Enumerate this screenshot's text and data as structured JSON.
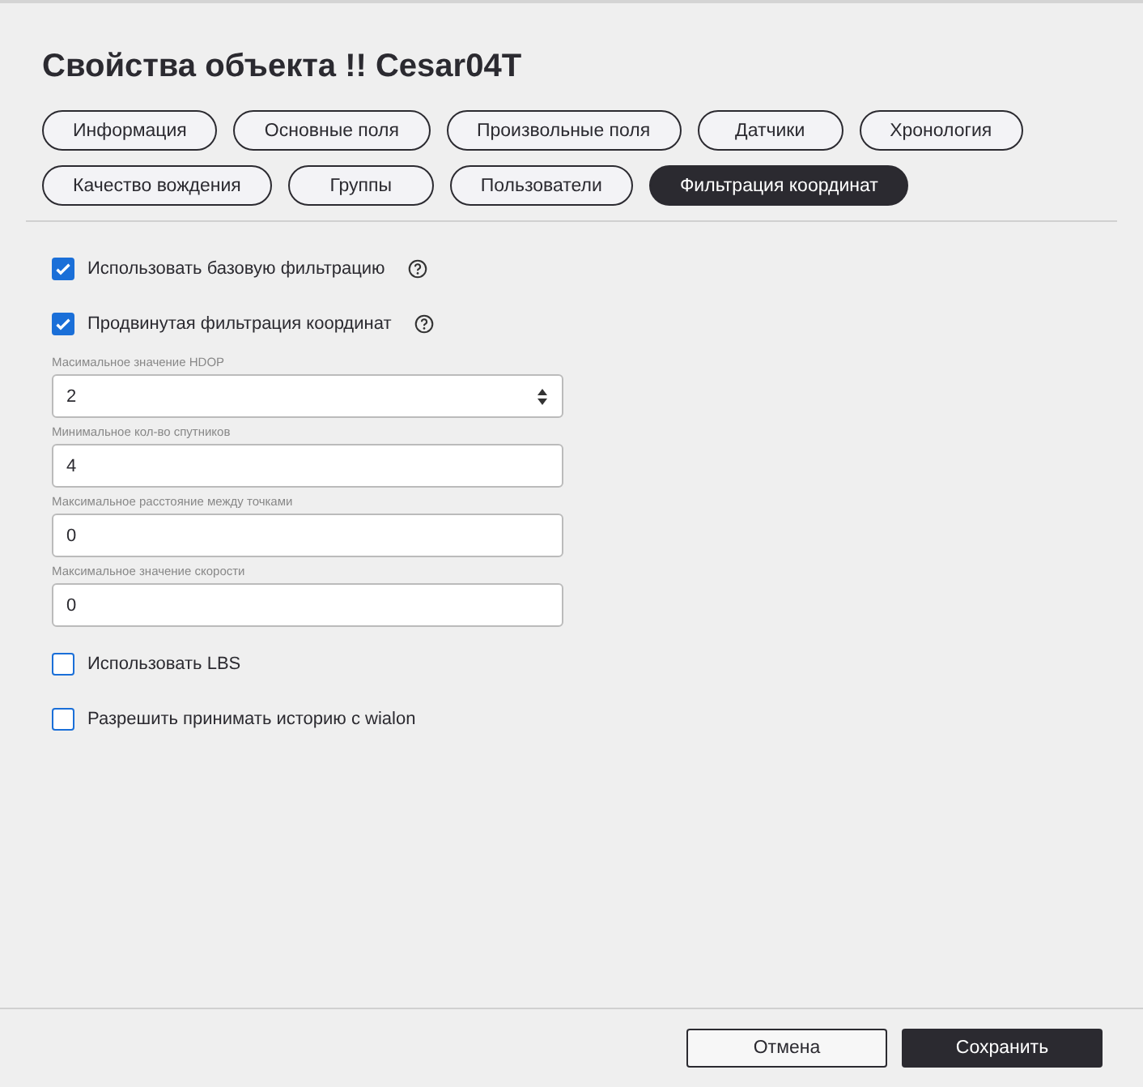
{
  "title": "Свойства объекта !! Cesar04T",
  "tabs": [
    {
      "label": "Информация",
      "selected": false
    },
    {
      "label": "Основные поля",
      "selected": false
    },
    {
      "label": "Произвольные поля",
      "selected": false
    },
    {
      "label": "Датчики",
      "selected": false
    },
    {
      "label": "Хронология",
      "selected": false
    },
    {
      "label": "Качество вождения",
      "selected": false
    },
    {
      "label": "Группы",
      "selected": false
    },
    {
      "label": "Пользователи",
      "selected": false
    },
    {
      "label": "Фильтрация координат",
      "selected": true
    }
  ],
  "settings": [
    {
      "kind": "checkbox",
      "label": "Использовать базовую фильтрацию",
      "checked": true,
      "help": true
    },
    {
      "kind": "checkbox",
      "label": "Продвинутая фильтрация координат",
      "checked": true,
      "help": true
    },
    {
      "kind": "field",
      "label": "Масимальное значение HDOP",
      "value": "2",
      "spinner": true
    },
    {
      "kind": "field",
      "label": "Минимальное кол-во спутников",
      "value": "4",
      "spinner": false
    },
    {
      "kind": "field",
      "label": "Максимальное расстояние между точками",
      "value": "0",
      "spinner": false
    },
    {
      "kind": "field",
      "label": "Максимальное значение скорости",
      "value": "0",
      "spinner": false
    },
    {
      "kind": "checkbox",
      "label": "Использовать LBS",
      "checked": false,
      "help": false
    },
    {
      "kind": "checkbox",
      "label": "Разрешить принимать историю с wialon",
      "checked": false,
      "help": false
    }
  ],
  "buttons": [
    {
      "label": "Отмена",
      "kind": "secondary"
    },
    {
      "label": "Сохранить",
      "kind": "primary"
    }
  ]
}
